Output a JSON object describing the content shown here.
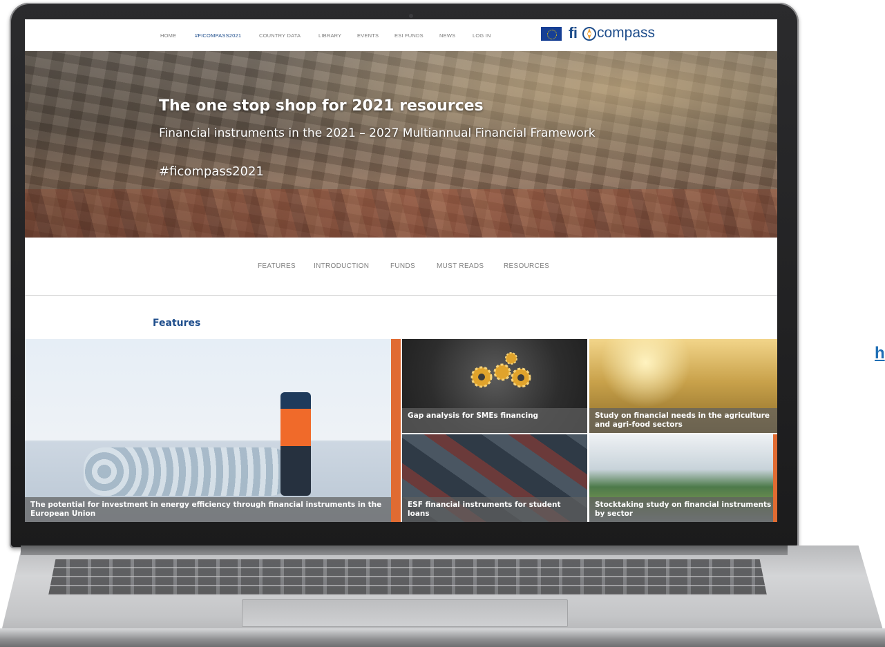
{
  "top_nav": {
    "items": [
      {
        "label": "HOME"
      },
      {
        "label": "#FICOMPASS2021",
        "active": true
      },
      {
        "label": "COUNTRY DATA"
      },
      {
        "label": "LIBRARY"
      },
      {
        "label": "EVENTS"
      },
      {
        "label": "ESI FUNDS"
      },
      {
        "label": "NEWS"
      },
      {
        "label": "LOG IN"
      }
    ]
  },
  "logo": {
    "part1": "fi",
    "part2": "compass"
  },
  "hero": {
    "title": "The one stop shop for 2021 resources",
    "subtitle": "Financial instruments in the 2021 – 2027 Multiannual Financial Framework",
    "hashtag": "#ficompass2021"
  },
  "section_nav": {
    "items": [
      {
        "label": "FEATURES"
      },
      {
        "label": "INTRODUCTION"
      },
      {
        "label": "FUNDS"
      },
      {
        "label": "MUST READS"
      },
      {
        "label": "RESOURCES"
      }
    ]
  },
  "features": {
    "heading": "Features",
    "tiles": [
      {
        "caption": "The potential for investment in energy efficiency through financial instruments in the European Union"
      },
      {
        "caption": "Gap analysis for SMEs financing"
      },
      {
        "caption": "Study on financial needs in the agriculture and agri-food sectors"
      },
      {
        "caption": "ESF financial instruments for student loans"
      },
      {
        "caption": "Stocktaking study on financial instruments by sector"
      }
    ]
  },
  "side_link": {
    "label": "h"
  },
  "colors": {
    "brand_blue": "#1f4e8c",
    "accent_orange": "#e06b32",
    "eu_blue": "#163f95",
    "eu_gold": "#f4d000"
  }
}
